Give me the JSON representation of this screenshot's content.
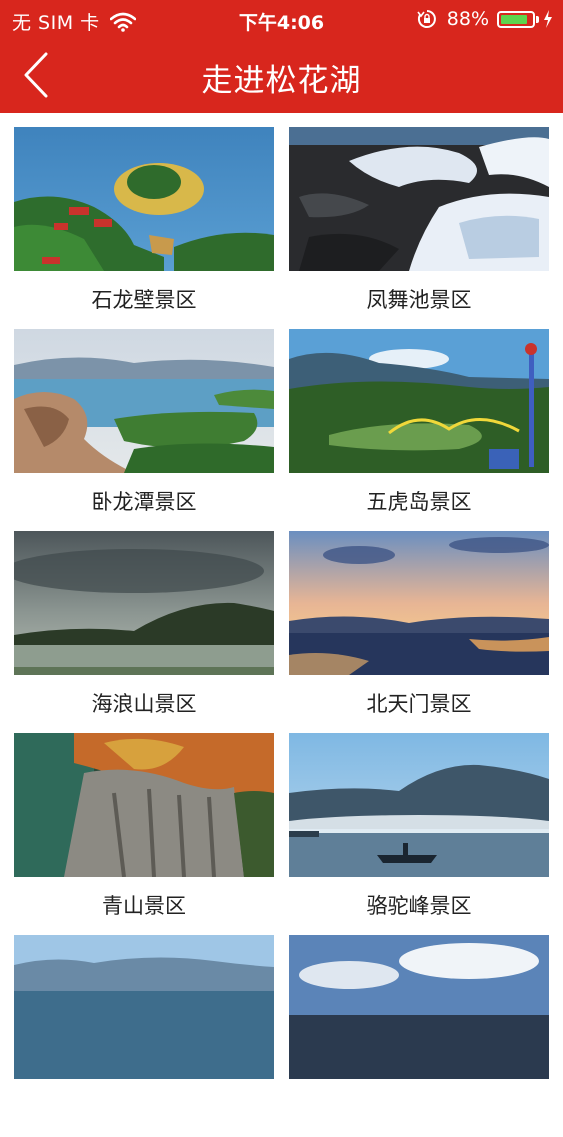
{
  "status_bar": {
    "carrier": "无 SIM 卡",
    "time": "下午4:06",
    "battery_percent": "88%",
    "battery_level": 0.88,
    "icons": [
      "wifi-icon",
      "rotation-lock-icon",
      "battery-icon",
      "charging-bolt-icon"
    ]
  },
  "nav": {
    "title": "走进松花湖",
    "back_icon": "chevron-left-icon"
  },
  "colors": {
    "header_red": "#d8261d",
    "label_text": "#222222",
    "background": "#ffffff"
  },
  "scenic_areas": [
    {
      "name": "石龙壁景区"
    },
    {
      "name": "凤舞池景区"
    },
    {
      "name": "卧龙潭景区"
    },
    {
      "name": "五虎岛景区"
    },
    {
      "name": "海浪山景区"
    },
    {
      "name": "北天门景区"
    },
    {
      "name": "青山景区"
    },
    {
      "name": "骆驼峰景区"
    },
    {
      "name": ""
    },
    {
      "name": ""
    }
  ]
}
